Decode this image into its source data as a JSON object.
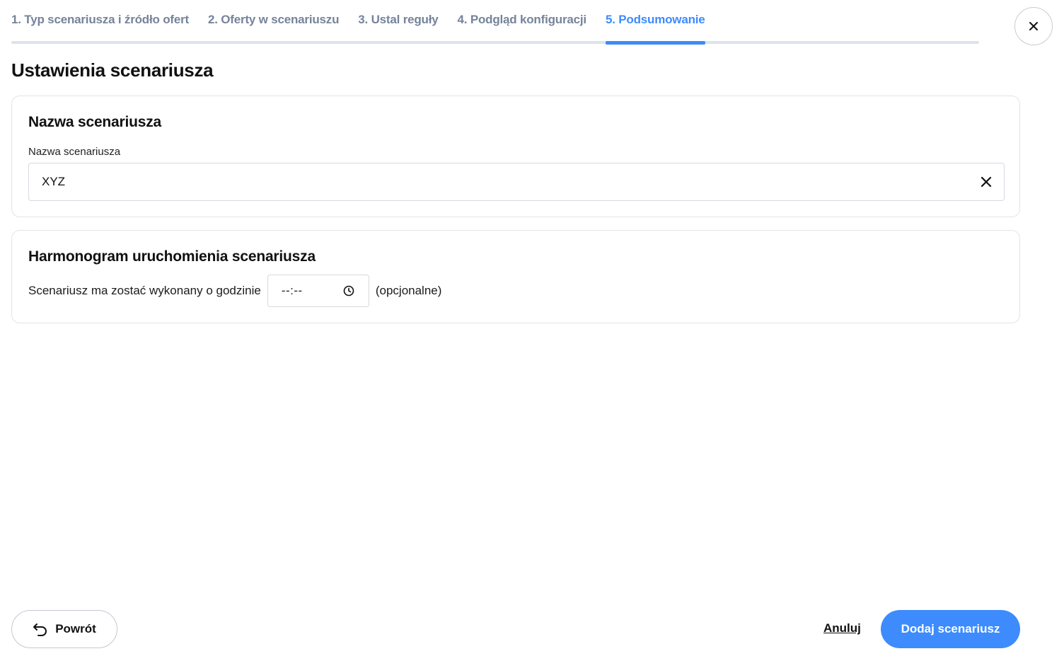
{
  "stepper": {
    "steps": [
      {
        "label": "1. Typ scenariusza i źródło ofert",
        "active": false
      },
      {
        "label": "2. Oferty w scenariuszu",
        "active": false
      },
      {
        "label": "3. Ustal reguły",
        "active": false
      },
      {
        "label": "4. Podgląd konfiguracji",
        "active": false
      },
      {
        "label": "5. Podsumowanie",
        "active": true
      }
    ],
    "active_color": "#3d8bfd",
    "inactive_color": "#76839a"
  },
  "header": {
    "close_icon": "close-icon"
  },
  "settings": {
    "title": "Ustawienia scenariusza",
    "name_card": {
      "title": "Nazwa scenariusza",
      "field_label": "Nazwa scenariusza",
      "field_value": "XYZ",
      "clear_icon": "close-icon"
    },
    "schedule_card": {
      "title": "Harmonogram uruchomienia scenariusza",
      "label": "Scenariusz ma zostać wykonany o godzinie",
      "time_value": "--:--",
      "time_icon": "clock-icon",
      "optional_label": "(opcjonalne)"
    }
  },
  "footer": {
    "back_label": "Powrót",
    "back_icon": "undo-arrow-icon",
    "cancel_label": "Anuluj",
    "submit_label": "Dodaj scenariusz",
    "accent_color": "#3d8bfd"
  }
}
